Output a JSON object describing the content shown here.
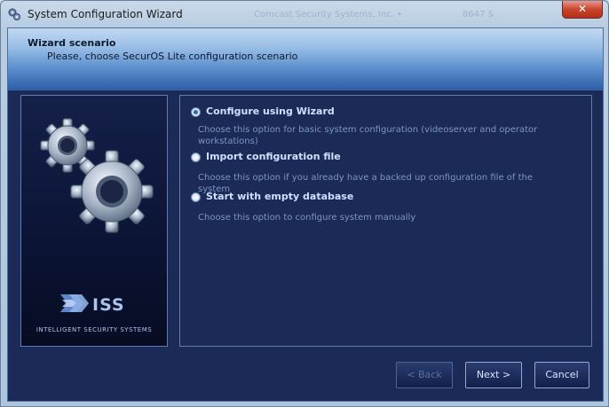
{
  "window": {
    "title": "System Configuration Wizard",
    "ghost_text": "Comcast Security Systems, Inc.  •",
    "ghost_text2": "8647  S"
  },
  "header": {
    "title": "Wizard scenario",
    "subtitle": "Please, choose SecurOS Lite configuration scenario"
  },
  "brand": {
    "logo_text": "ISS",
    "tagline": "INTELLIGENT SECURITY SYSTEMS"
  },
  "options": [
    {
      "label": "Configure using Wizard",
      "description": "Choose this option for basic system configuration (videoserver and operator workstations)",
      "selected": true
    },
    {
      "label": "Import configuration file",
      "description": "Choose this option if you already have a backed up configuration file of the system",
      "selected": false
    },
    {
      "label": "Start with empty database",
      "description": "Choose this option to configure system manually",
      "selected": false
    }
  ],
  "buttons": {
    "back": "< Back",
    "next": "Next >",
    "cancel": "Cancel"
  },
  "colors": {
    "client_bg": "#1b2a56",
    "option_label": "#cfe0ff",
    "option_desc": "#7e95c4",
    "close_button": "#c9452e"
  },
  "icons": {
    "app": "wizard-icon",
    "close": "close-icon",
    "gears": "gears-icon",
    "logo": "iss-logo-icon"
  }
}
